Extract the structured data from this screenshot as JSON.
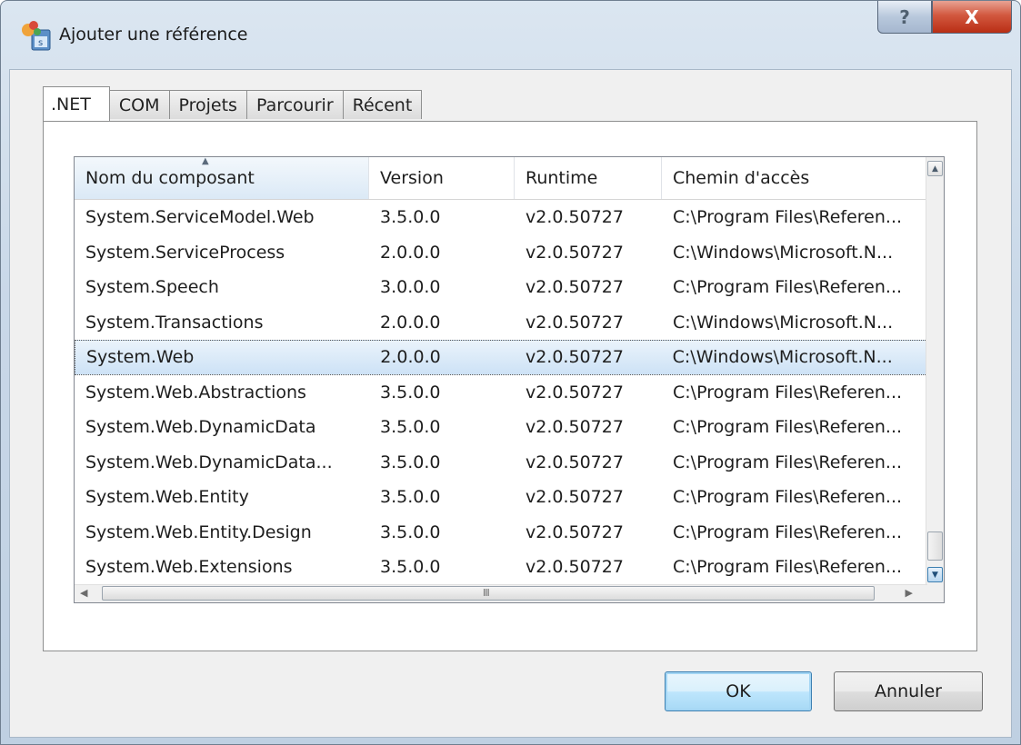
{
  "window": {
    "title": "Ajouter une référence",
    "help_label": "?",
    "close_label": "X"
  },
  "tabs": [
    {
      "label": ".NET",
      "active": true
    },
    {
      "label": "COM",
      "active": false
    },
    {
      "label": "Projets",
      "active": false
    },
    {
      "label": "Parcourir",
      "active": false
    },
    {
      "label": "Récent",
      "active": false
    }
  ],
  "list": {
    "columns": [
      "Nom du composant",
      "Version",
      "Runtime",
      "Chemin d'accès"
    ],
    "sorted_column": "Nom du composant",
    "rows": [
      {
        "name": "System.ServiceModel.Web",
        "version": "3.5.0.0",
        "runtime": "v2.0.50727",
        "path": "C:\\Program Files\\Referen..."
      },
      {
        "name": "System.ServiceProcess",
        "version": "2.0.0.0",
        "runtime": "v2.0.50727",
        "path": "C:\\Windows\\Microsoft.N..."
      },
      {
        "name": "System.Speech",
        "version": "3.0.0.0",
        "runtime": "v2.0.50727",
        "path": "C:\\Program Files\\Referen..."
      },
      {
        "name": "System.Transactions",
        "version": "2.0.0.0",
        "runtime": "v2.0.50727",
        "path": "C:\\Windows\\Microsoft.N..."
      },
      {
        "name": "System.Web",
        "version": "2.0.0.0",
        "runtime": "v2.0.50727",
        "path": "C:\\Windows\\Microsoft.N...",
        "selected": true
      },
      {
        "name": "System.Web.Abstractions",
        "version": "3.5.0.0",
        "runtime": "v2.0.50727",
        "path": "C:\\Program Files\\Referen..."
      },
      {
        "name": "System.Web.DynamicData",
        "version": "3.5.0.0",
        "runtime": "v2.0.50727",
        "path": "C:\\Program Files\\Referen..."
      },
      {
        "name": "System.Web.DynamicData...",
        "version": "3.5.0.0",
        "runtime": "v2.0.50727",
        "path": "C:\\Program Files\\Referen..."
      },
      {
        "name": "System.Web.Entity",
        "version": "3.5.0.0",
        "runtime": "v2.0.50727",
        "path": "C:\\Program Files\\Referen..."
      },
      {
        "name": "System.Web.Entity.Design",
        "version": "3.5.0.0",
        "runtime": "v2.0.50727",
        "path": "C:\\Program Files\\Referen..."
      },
      {
        "name": "System.Web.Extensions",
        "version": "3.5.0.0",
        "runtime": "v2.0.50727",
        "path": "C:\\Program Files\\Referen..."
      }
    ]
  },
  "buttons": {
    "ok_label": "OK",
    "cancel_label": "Annuler"
  },
  "icons": {
    "app": "add-reference-icon",
    "help": "help-icon",
    "close": "close-icon",
    "sort": "sort-ascending-icon"
  },
  "colors": {
    "close_button": "#c73d22",
    "selected_row": "#cde2f6",
    "ok_button_border": "#3c7fb1"
  }
}
